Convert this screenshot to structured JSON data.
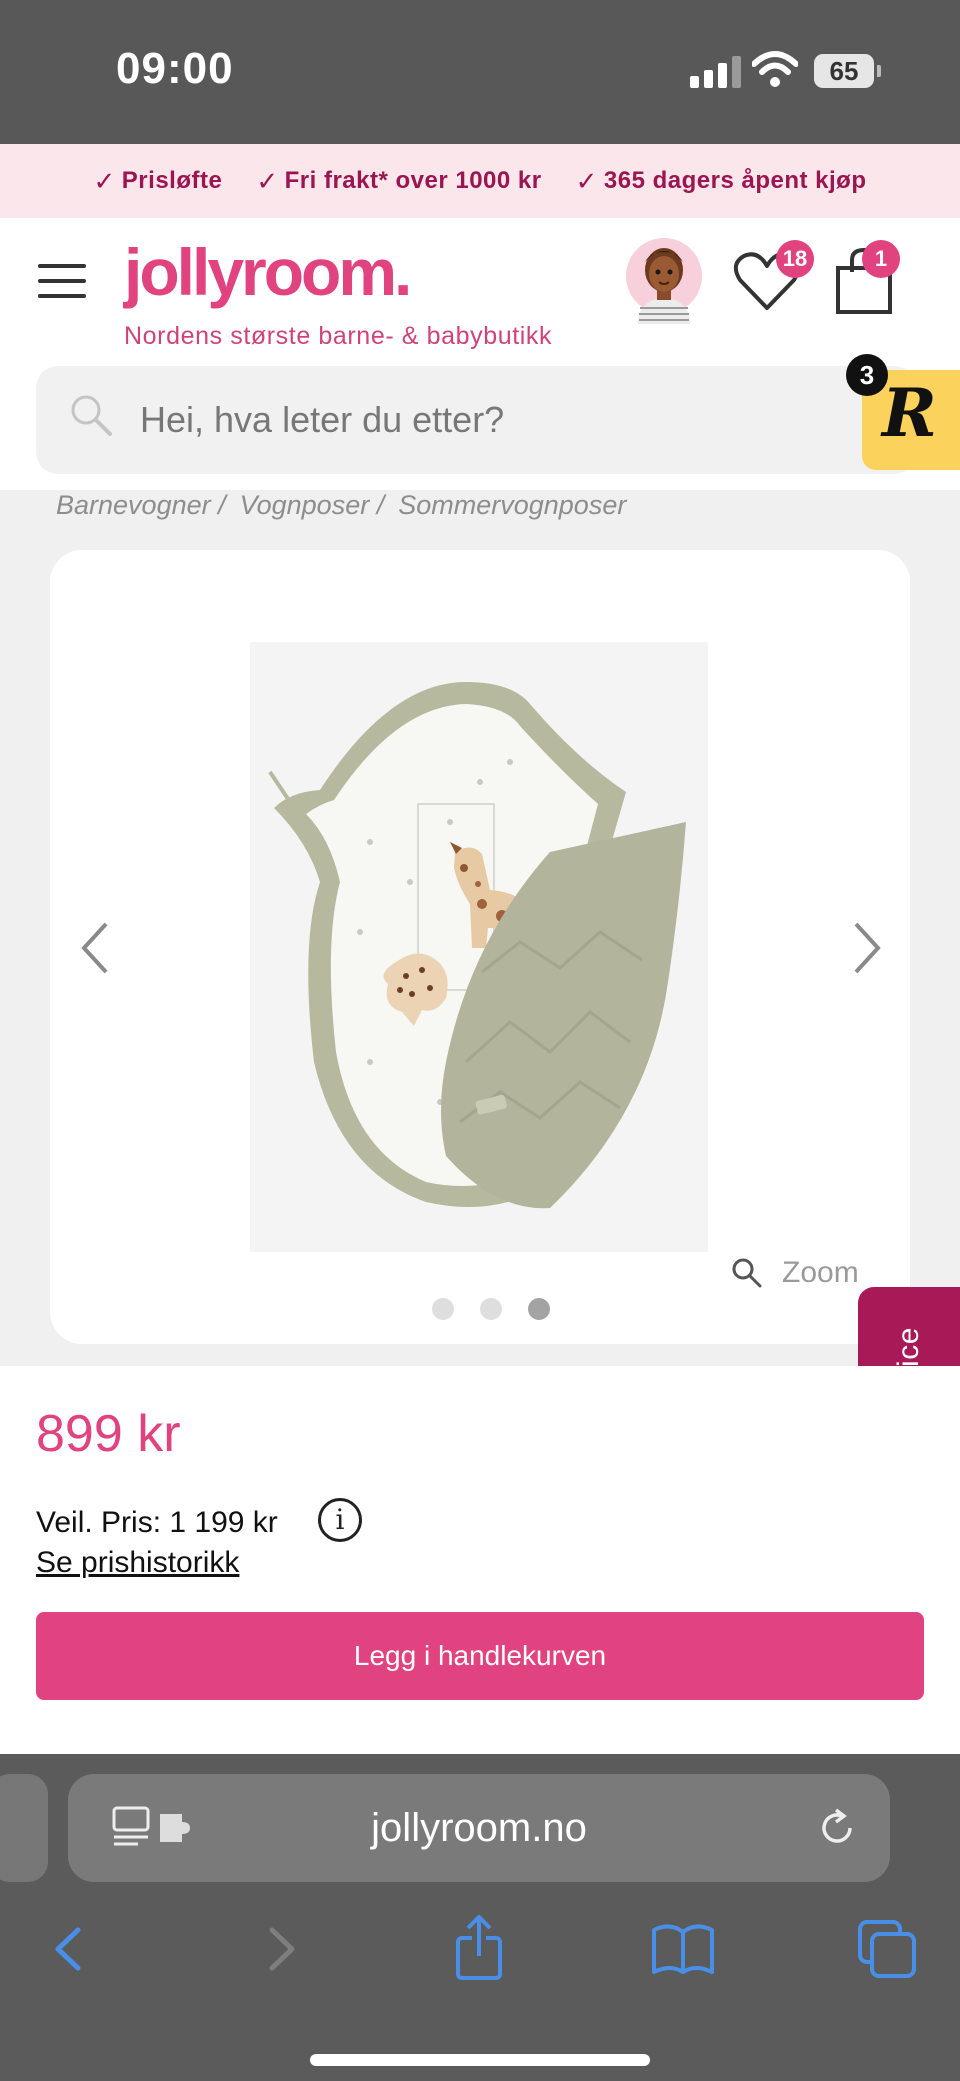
{
  "status_bar": {
    "time": "09:00",
    "battery": "65"
  },
  "promo": {
    "items": [
      {
        "label": "Prisløfte"
      },
      {
        "label": "Fri frakt* over 1000 kr"
      },
      {
        "label": "365 dagers åpent kjøp"
      }
    ]
  },
  "header": {
    "logo": "jollyroom.",
    "tagline": "Nordens største barne- & babybutikk",
    "wishlist_count": "18",
    "cart_count": "1",
    "rewards_count": "3",
    "rewards_letter": "R"
  },
  "search": {
    "placeholder": "Hei, hva leter du etter?"
  },
  "breadcrumbs": [
    {
      "label": "Barnevogner /"
    },
    {
      "label": "Vognposer /"
    },
    {
      "label": "Sommervognposer"
    }
  ],
  "gallery": {
    "zoom_label": "Zoom",
    "slide_count": 3,
    "active_slide": 3
  },
  "customer_service": {
    "label": "Kundeservice"
  },
  "product": {
    "price": "899 kr",
    "recommended_price": "Veil. Pris: 1 199 kr",
    "info_symbol": "i",
    "price_history_link": "Se prishistorikk",
    "add_to_cart": "Legg i handlekurven"
  },
  "browser": {
    "url": "jollyroom.no"
  },
  "colors": {
    "brand": "#e0437f",
    "promo_text": "#9b1550",
    "customer_service": "#a81a57",
    "browser_accent": "#4a8fe7"
  }
}
